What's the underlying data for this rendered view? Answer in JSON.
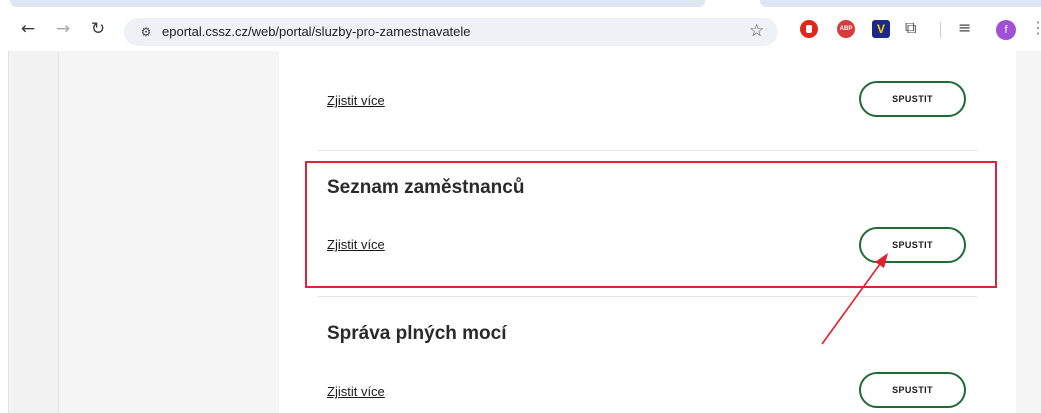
{
  "browser": {
    "url": "eportal.cssz.cz/web/portal/sluzby-pro-zamestnavatele",
    "avatar_letter": "f",
    "extensions": [
      "stop-extension",
      "abp-extension",
      "v-extension"
    ],
    "icons": {
      "back": "arrow-left-icon",
      "forward": "arrow-right-icon",
      "reload": "reload-icon",
      "site_info": "tune-icon",
      "bookmark": "star-icon",
      "extensions": "puzzle-icon",
      "reading_list": "playlist-icon",
      "menu": "kebab-icon"
    },
    "ext_labels": {
      "abp": "ABP",
      "v": "V"
    }
  },
  "services": [
    {
      "title": "",
      "link_label": "Zjistit více",
      "button_label": "SPUSTIT"
    },
    {
      "title": "Seznam zaměstnanců",
      "link_label": "Zjistit více",
      "button_label": "SPUSTIT"
    },
    {
      "title": "Správa plných mocí",
      "link_label": "Zjistit více",
      "button_label": "SPUSTIT"
    }
  ],
  "annotation": {
    "highlight_color": "#d9263a",
    "target": "services.1.button_label"
  },
  "colors": {
    "button_border": "#1f6b34",
    "panel_bg": "#ffffff",
    "page_bg": "#f2f2f2"
  }
}
